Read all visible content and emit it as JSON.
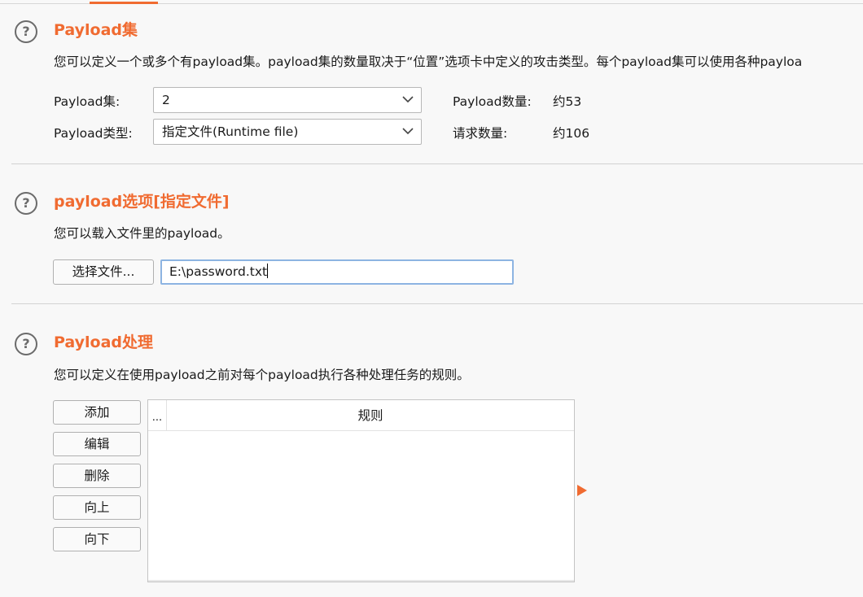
{
  "payload_sets": {
    "title": "Payload集",
    "description": "您可以定义一个或多个有payload集。payload集的数量取决于“位置”选项卡中定义的攻击类型。每个payload集可以使用各种payloa",
    "set_label": "Payload集:",
    "set_value": "2",
    "type_label": "Payload类型:",
    "type_value": "指定文件(Runtime file)",
    "count_label": "Payload数量:",
    "count_value": "约53",
    "requests_label": "请求数量:",
    "requests_value": "约106"
  },
  "payload_options": {
    "title": "payload选项[指定文件]",
    "description": "您可以载入文件里的payload。",
    "choose_file_label": "选择文件...",
    "file_path": "E:\\password.txt"
  },
  "payload_processing": {
    "title": "Payload处理",
    "description": "您可以定义在使用payload之前对每个payload执行各种处理任务的规则。",
    "buttons": {
      "add": "添加",
      "edit": "编辑",
      "remove": "删除",
      "up": "向上",
      "down": "向下"
    },
    "table": {
      "col_dots": "...",
      "col_rule": "规则"
    }
  },
  "icons": {
    "help": "?"
  },
  "colors": {
    "accent": "#f06b31",
    "focus_border": "#8db4e2"
  }
}
